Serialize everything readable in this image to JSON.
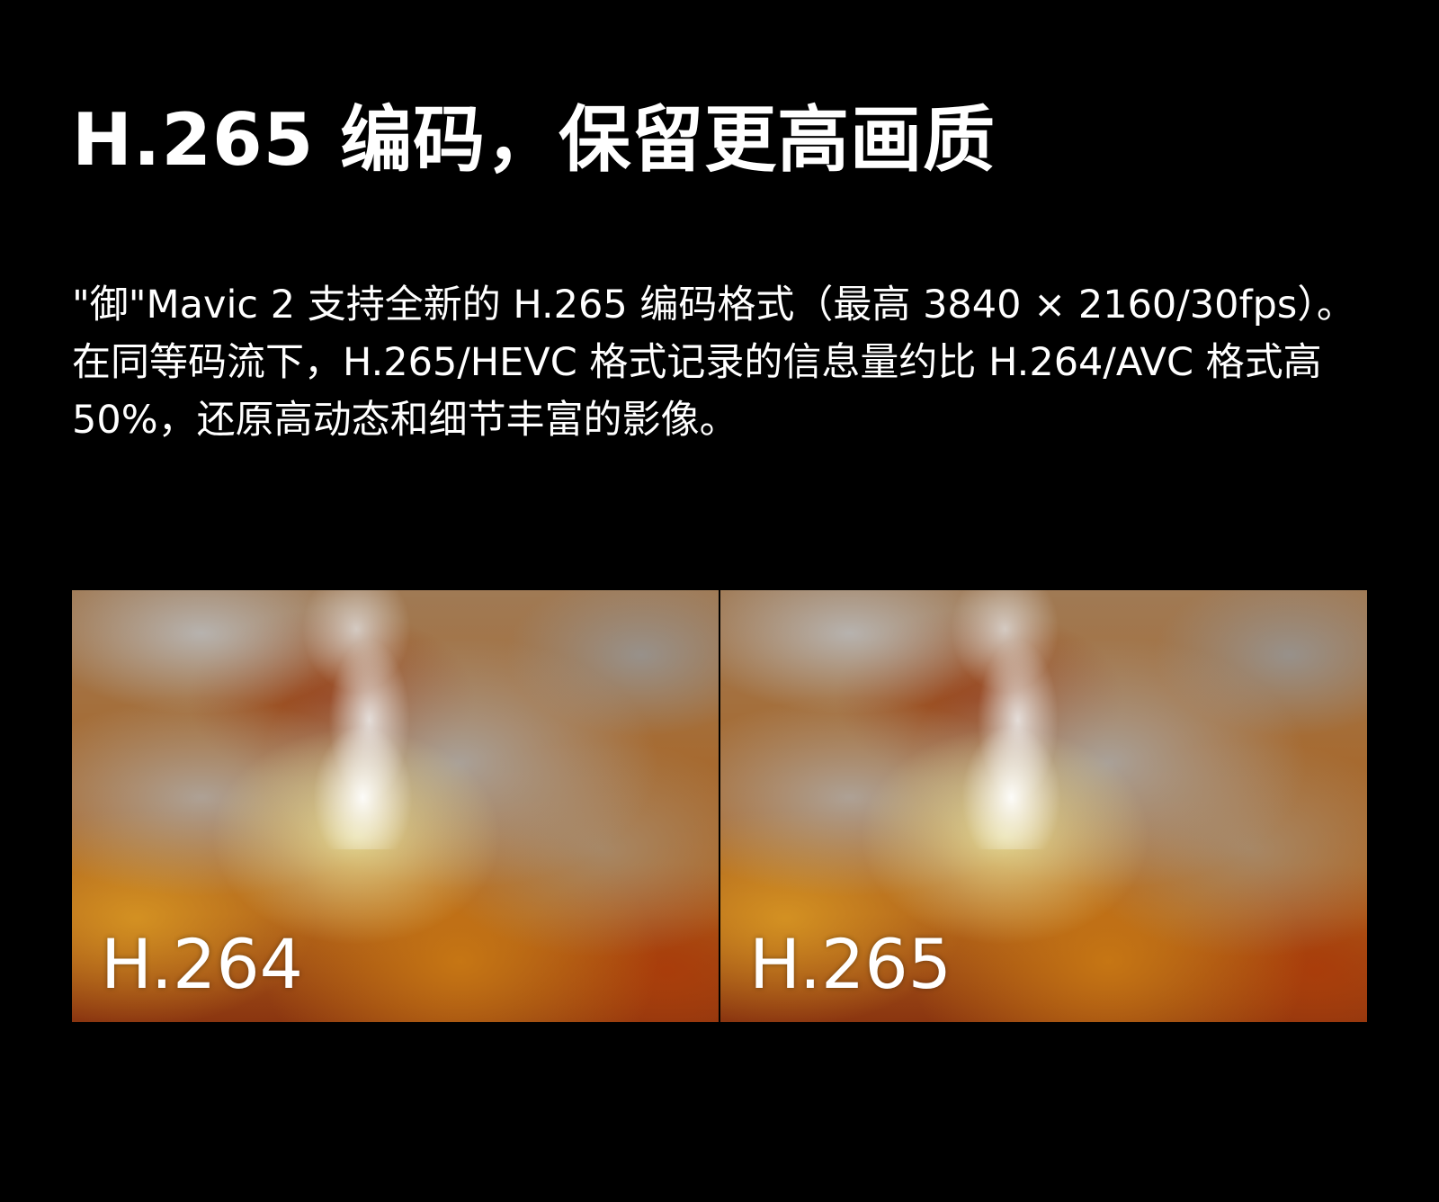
{
  "headline": "H.265 编码，保留更高画质",
  "description": {
    "lines": [
      "\"御\"Mavic 2 支持全新的 H.265 编码格式（最高 3840 × 2160/30fps）。",
      "在同等码流下，H.265/HEVC 格式记录的信息量约比 H.264/AVC 格式高",
      "50%，还原高动态和细节丰富的影像。"
    ]
  },
  "comparison": {
    "left_label": "H.264",
    "right_label": "H.265"
  },
  "colors": {
    "background": "#000000",
    "text": "#ffffff"
  }
}
